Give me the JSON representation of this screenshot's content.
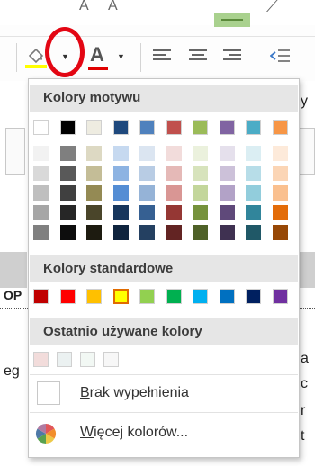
{
  "dropdown": {
    "theme_header": "Kolory motywu",
    "standard_header": "Kolory standardowe",
    "recent_header": "Ostatnio używane kolory",
    "no_fill": {
      "accel": "B",
      "rest": "rak wypełnienia"
    },
    "more_colors": {
      "accel": "W",
      "rest": "ięcej kolorów..."
    }
  },
  "theme_colors": [
    {
      "base": "#ffffff",
      "shades": [
        "#f2f2f2",
        "#d9d9d9",
        "#bfbfbf",
        "#a6a6a6",
        "#808080"
      ]
    },
    {
      "base": "#000000",
      "shades": [
        "#7f7f7f",
        "#595959",
        "#404040",
        "#262626",
        "#0d0d0d"
      ]
    },
    {
      "base": "#eeece1",
      "shades": [
        "#ddd9c3",
        "#c4bd97",
        "#948a54",
        "#4a452a",
        "#1d1b10"
      ]
    },
    {
      "base": "#1f497d",
      "shades": [
        "#c6d9f0",
        "#8db3e2",
        "#548dd4",
        "#17365d",
        "#0f243e"
      ]
    },
    {
      "base": "#4f81bd",
      "shades": [
        "#dbe5f1",
        "#b8cce4",
        "#95b3d7",
        "#366092",
        "#244061"
      ]
    },
    {
      "base": "#c0504d",
      "shades": [
        "#f2dcdb",
        "#e5b9b7",
        "#d99694",
        "#953734",
        "#632423"
      ]
    },
    {
      "base": "#9bbb59",
      "shades": [
        "#ebf1dd",
        "#d7e3bc",
        "#c3d69b",
        "#76923c",
        "#4f6128"
      ]
    },
    {
      "base": "#8064a2",
      "shades": [
        "#e5e0ec",
        "#ccc1d9",
        "#b2a2c7",
        "#5f497a",
        "#3f3151"
      ]
    },
    {
      "base": "#4bacc6",
      "shades": [
        "#dbeef3",
        "#b7dde8",
        "#92cddc",
        "#31859b",
        "#205867"
      ]
    },
    {
      "base": "#f79646",
      "shades": [
        "#fdeada",
        "#fbd5b5",
        "#fac08f",
        "#e36c09",
        "#974806"
      ]
    }
  ],
  "standard_colors": [
    "#c00000",
    "#ff0000",
    "#ffc000",
    "#ffff00",
    "#92d050",
    "#00b050",
    "#00b0f0",
    "#0070c0",
    "#002060",
    "#7030a0"
  ],
  "selected_standard_index": 3,
  "recent_colors": [
    "#f2dcdb",
    "#ebf1f1",
    "#f2f8f4",
    "#f7f7f7"
  ],
  "ribbon": {
    "fill_color": "#ffff00",
    "font_color": "#e00000",
    "font_color_letter": "A",
    "top_glyphs": [
      "A",
      "A",
      "A"
    ],
    "annotation_color": "#e30613"
  },
  "sheet": {
    "edge_left": [
      "OP",
      "eg"
    ],
    "edge_right": [
      "y",
      "a",
      "c",
      "r",
      "t"
    ]
  }
}
